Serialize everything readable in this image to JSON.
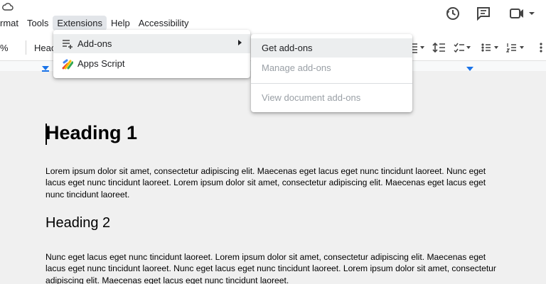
{
  "menubar": {
    "items": [
      "rmat",
      "Tools",
      "Extensions",
      "Help",
      "Accessibility"
    ],
    "active_index": 2
  },
  "toolbar": {
    "zoom_label": "%",
    "style_label": "Heac"
  },
  "extensions_menu": {
    "items": [
      {
        "label": "Add-ons",
        "icon": "add-ons-icon",
        "has_submenu": true
      },
      {
        "label": "Apps Script",
        "icon": "apps-script-icon",
        "has_submenu": false
      }
    ]
  },
  "addons_submenu": {
    "items": [
      {
        "label": "Get add-ons",
        "enabled": true
      },
      {
        "label": "Manage add-ons",
        "enabled": false
      },
      {
        "label": "View document add-ons",
        "enabled": false
      }
    ]
  },
  "document": {
    "heading1": "Heading 1",
    "paragraph1": "Lorem ipsum dolor sit amet, consectetur adipiscing elit. Maecenas eget lacus eget nunc tincidunt laoreet. Nunc eget lacus eget nunc tincidunt laoreet. Lorem ipsum dolor sit amet, consectetur adipiscing elit. Maecenas eget lacus eget nunc tincidunt laoreet.",
    "heading2": "Heading 2",
    "paragraph2": "Nunc eget lacus eget nunc tincidunt laoreet. Lorem ipsum dolor sit amet, consectetur adipiscing elit. Maecenas eget lacus eget nunc tincidunt laoreet. Nunc eget lacus eget nunc tincidunt laoreet. Lorem ipsum dolor sit amet, consectetur adipiscing elit. Maecenas eget lacus eget nunc tincidunt laoreet."
  },
  "header_icons": [
    "history-icon",
    "comment-icon",
    "video-camera-icon"
  ],
  "toolbar_icons": [
    "align-icon",
    "line-spacing-icon",
    "checklist-icon",
    "bulleted-list-icon",
    "numbered-list-icon"
  ],
  "colors": {
    "accent": "#1a73e8",
    "menu_active": "#e2e5e9",
    "disabled_text": "#9aa0a6",
    "page_background": "#f0f0f0"
  }
}
